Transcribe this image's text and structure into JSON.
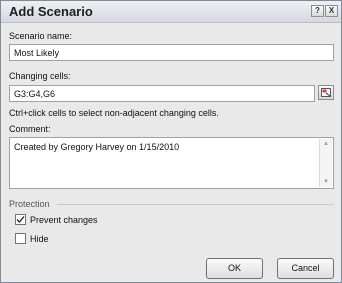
{
  "dialog": {
    "title": "Add Scenario",
    "help_glyph": "?",
    "close_glyph": "X"
  },
  "scenario_name": {
    "label": "Scenario name:",
    "value": "Most Likely"
  },
  "changing_cells": {
    "label": "Changing cells:",
    "value": "G3:G4,G6",
    "hint": "Ctrl+click cells to select non-adjacent changing cells."
  },
  "comment": {
    "label": "Comment:",
    "value": "Created by Gregory Harvey on 1/15/2010"
  },
  "protection": {
    "label": "Protection",
    "prevent_changes": {
      "label": "Prevent changes",
      "checked": true
    },
    "hide": {
      "label": "Hide",
      "checked": false
    }
  },
  "buttons": {
    "ok": "OK",
    "cancel": "Cancel"
  }
}
